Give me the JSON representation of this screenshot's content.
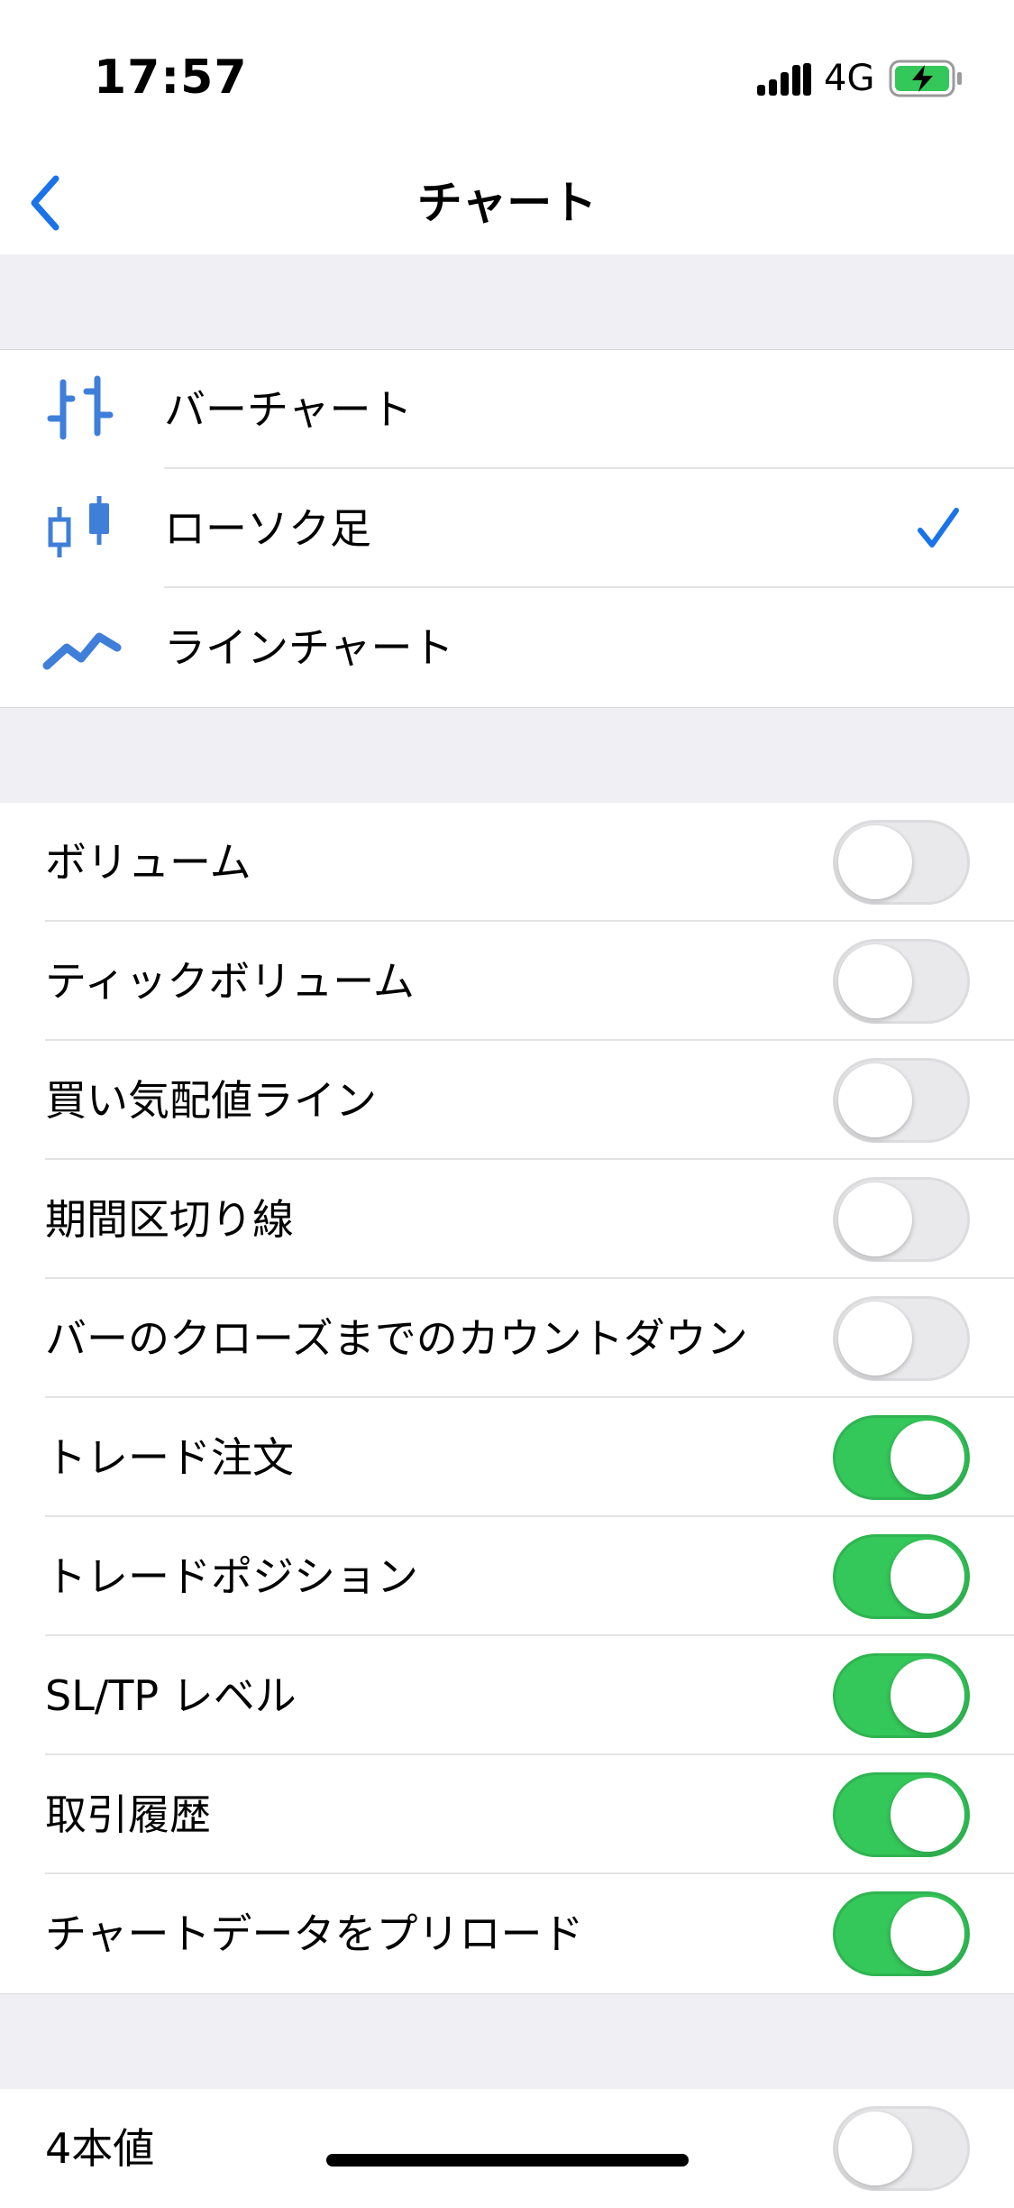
{
  "status": {
    "time": "17:57",
    "network": "4G"
  },
  "nav": {
    "title": "チャート"
  },
  "chart_types": [
    {
      "label": "バーチャート",
      "icon": "bar-chart-icon",
      "selected": false
    },
    {
      "label": "ローソク足",
      "icon": "candlestick-icon",
      "selected": true
    },
    {
      "label": "ラインチャート",
      "icon": "line-chart-icon",
      "selected": false
    }
  ],
  "settings": [
    {
      "label": "ボリューム",
      "on": false
    },
    {
      "label": "ティックボリューム",
      "on": false
    },
    {
      "label": "買い気配値ライン",
      "on": false
    },
    {
      "label": "期間区切り線",
      "on": false
    },
    {
      "label": "バーのクローズまでのカウントダウン",
      "on": false
    },
    {
      "label": "トレード注文",
      "on": true
    },
    {
      "label": "トレードポジション",
      "on": true
    },
    {
      "label": "SL/TP レベル",
      "on": true
    },
    {
      "label": "取引履歴",
      "on": true
    },
    {
      "label": "チャートデータをプリロード",
      "on": true
    }
  ],
  "settings2": [
    {
      "label": "4本値",
      "on": false
    }
  ],
  "colors": {
    "accent": "#1a73e8",
    "toggle_on": "#34c759",
    "toggle_off": "#e9e9eb",
    "group_gap": "#efeff4"
  }
}
